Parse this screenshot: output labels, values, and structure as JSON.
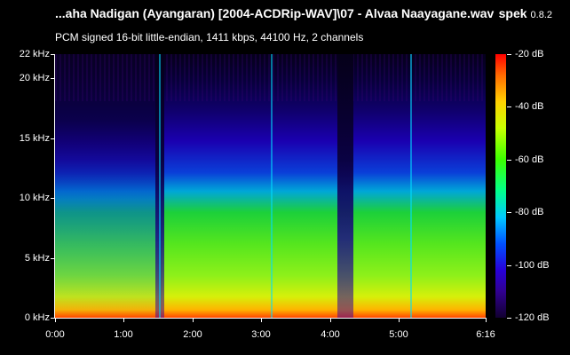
{
  "header": {
    "file_title": "...aha Nadigan (Ayangaran) [2004-ACDRip-WAV]\\07 - Alvaa Naayagane.wav",
    "app_name": "spek",
    "app_version": "0.8.2"
  },
  "info_line": "PCM signed 16-bit little-endian, 1411 kbps, 44100 Hz, 2 channels",
  "frequency_axis": [
    "22 kHz",
    "20 kHz",
    "15 kHz",
    "10 kHz",
    "5 kHz",
    "0 kHz"
  ],
  "time_axis": [
    "0:00",
    "1:00",
    "2:00",
    "3:00",
    "4:00",
    "5:00",
    "6:16"
  ],
  "db_scale": [
    "-20 dB",
    "-40 dB",
    "-60 dB",
    "-80 dB",
    "-100 dB",
    "-120 dB"
  ],
  "colors": {
    "background": "#000000",
    "text": "#ffffff"
  }
}
